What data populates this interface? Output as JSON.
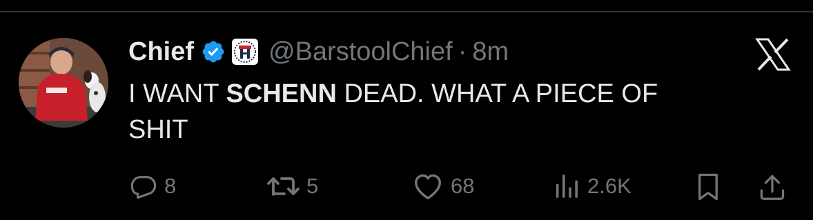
{
  "tweet": {
    "author_name": "Chief",
    "handle": "@BarstoolChief",
    "separator": "·",
    "time": "8m",
    "text_part1": "I WANT ",
    "text_bold": "SCHENN",
    "text_part2": " DEAD. WHAT A PIECE OF",
    "text_line2": "SHIT"
  },
  "actions": {
    "replies": "8",
    "retweets": "5",
    "likes": "68",
    "views": "2.6K"
  },
  "icons": [
    "verified-badge-icon",
    "barstool-affiliate-icon",
    "close-icon",
    "reply-icon",
    "retweet-icon",
    "like-icon",
    "views-icon",
    "bookmark-icon",
    "share-icon"
  ],
  "colors": {
    "background": "#000000",
    "text": "#e7e9ea",
    "muted": "#71767b",
    "verified": "#1d9bf0"
  }
}
